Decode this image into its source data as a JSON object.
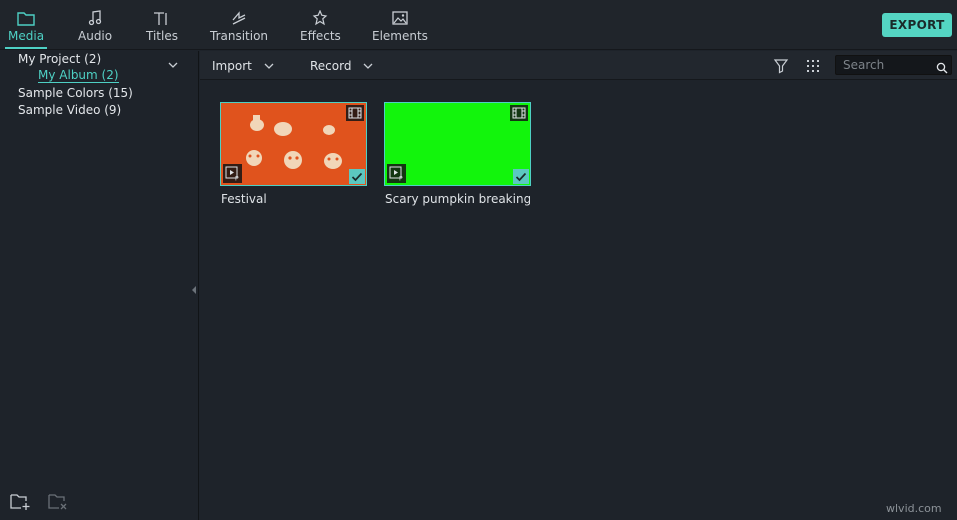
{
  "tabs": [
    {
      "label": "Media",
      "icon": "folder-icon",
      "active": true
    },
    {
      "label": "Audio",
      "icon": "music-note-icon",
      "active": false
    },
    {
      "label": "Titles",
      "icon": "text-icon",
      "active": false
    },
    {
      "label": "Transition",
      "icon": "transition-icon",
      "active": false
    },
    {
      "label": "Effects",
      "icon": "effects-icon",
      "active": false
    },
    {
      "label": "Elements",
      "icon": "image-icon",
      "active": false
    }
  ],
  "export_label": "EXPORT",
  "tree": {
    "project": "My Project (2)",
    "album": "My Album (2)",
    "colors": "Sample Colors (15)",
    "video": "Sample Video (9)"
  },
  "toolbar": {
    "import_label": "Import",
    "record_label": "Record",
    "search_placeholder": "Search"
  },
  "media": [
    {
      "title": "Festival",
      "thumb_color": "#e0531d",
      "selected": true
    },
    {
      "title": "Scary pumpkin breaking s...",
      "thumb_color": "#12f50c",
      "selected": true
    }
  ],
  "colors": {
    "accent": "#4ed0c4",
    "export_bg": "#54d5c3",
    "background": "#1e232a"
  },
  "watermark": "wlvid.com"
}
